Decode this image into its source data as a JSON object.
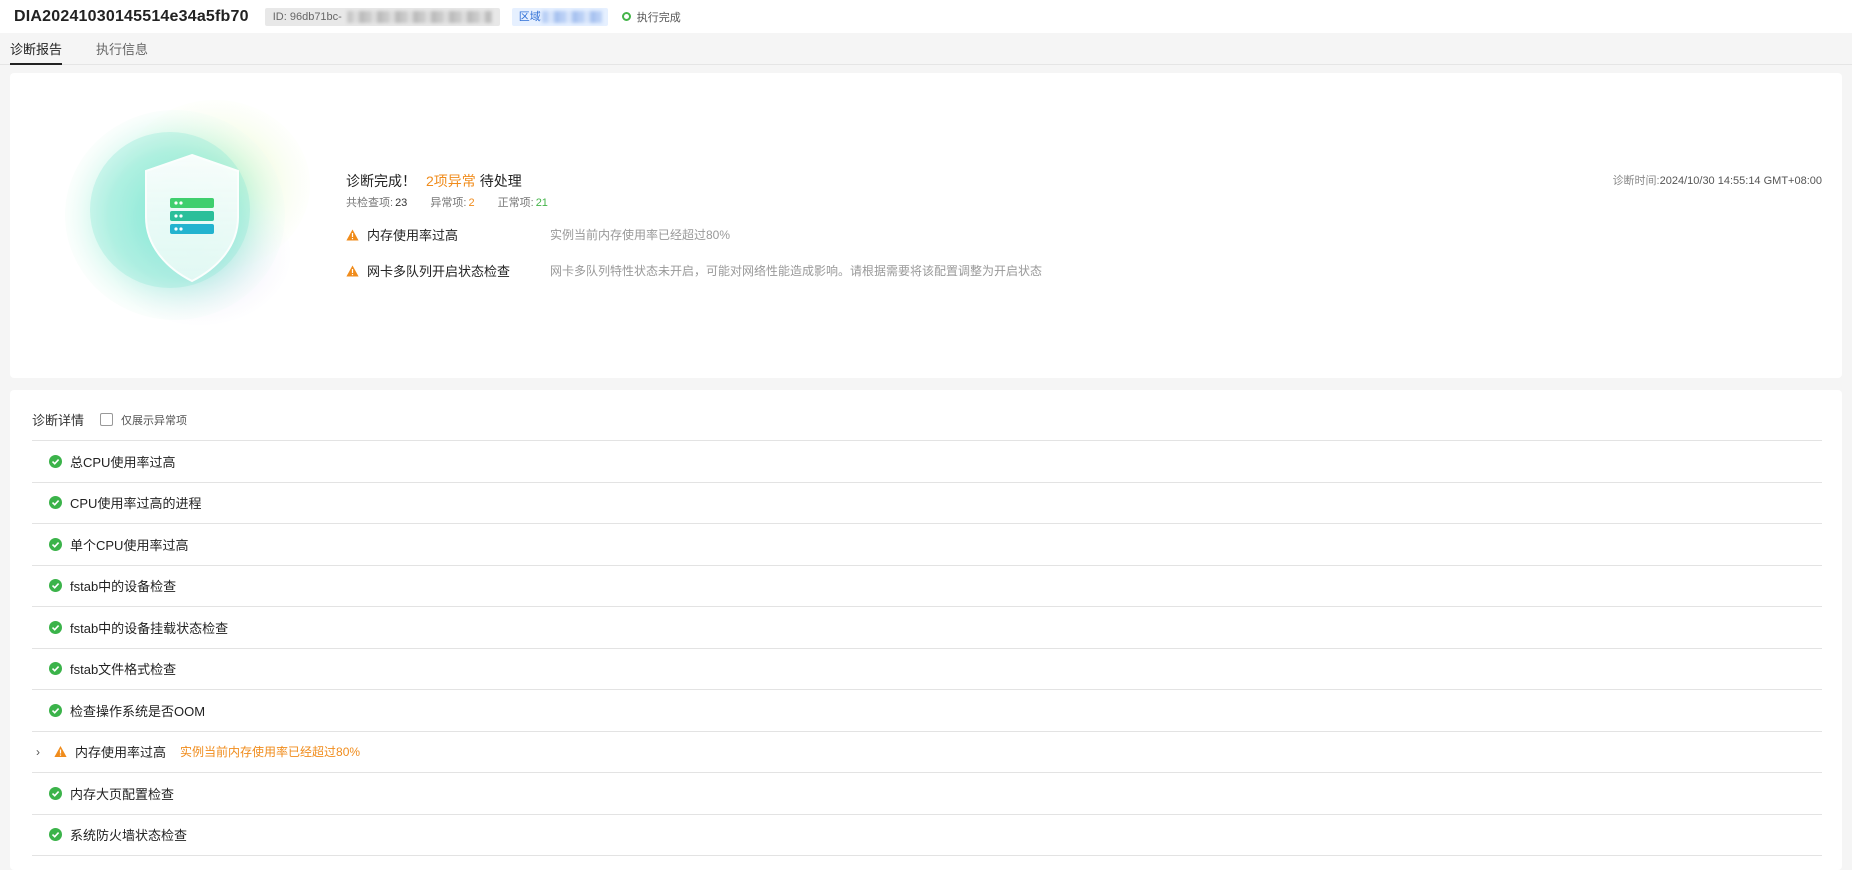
{
  "header": {
    "task_id": "DIA20241030145514e34a5fb70",
    "id_label": "ID: 96db71bc-",
    "region_label": "区域",
    "status": "执行完成"
  },
  "tabs": [
    {
      "label": "诊断报告",
      "active": true
    },
    {
      "label": "执行信息",
      "active": false
    }
  ],
  "summary": {
    "title_prefix": "诊断完成！",
    "title_abnormal": "2项异常",
    "title_suffix": "待处理",
    "total_label": "共检查项:",
    "total_value": "23",
    "abnormal_label": "异常项:",
    "abnormal_value": "2",
    "normal_label": "正常项:",
    "normal_value": "21",
    "diag_time_label": "诊断时间:",
    "diag_time_value": "2024/10/30 14:55:14 GMT+08:00",
    "issues": [
      {
        "name": "内存使用率过高",
        "desc": "实例当前内存使用率已经超过80%"
      },
      {
        "name": "网卡多队列开启状态检查",
        "desc": "网卡多队列特性状态未开启，可能对网络性能造成影响。请根据需要将该配置调整为开启状态"
      }
    ]
  },
  "details": {
    "title": "诊断详情",
    "filter_label": "仅展示异常项",
    "rows": [
      {
        "name": "总CPU使用率过高",
        "status": "ok"
      },
      {
        "name": "CPU使用率过高的进程",
        "status": "ok"
      },
      {
        "name": "单个CPU使用率过高",
        "status": "ok"
      },
      {
        "name": "fstab中的设备检查",
        "status": "ok"
      },
      {
        "name": "fstab中的设备挂载状态检查",
        "status": "ok"
      },
      {
        "name": "fstab文件格式检查",
        "status": "ok"
      },
      {
        "name": "检查操作系统是否OOM",
        "status": "ok"
      },
      {
        "name": "内存使用率过高",
        "status": "abnormal",
        "desc": "实例当前内存使用率已经超过80%"
      },
      {
        "name": "内存大页配置检查",
        "status": "ok"
      },
      {
        "name": "系统防火墙状态检查",
        "status": "ok"
      }
    ]
  },
  "colors": {
    "ok": "#3bb34a",
    "warn": "#f08c1c",
    "link": "#2f6fd6"
  }
}
